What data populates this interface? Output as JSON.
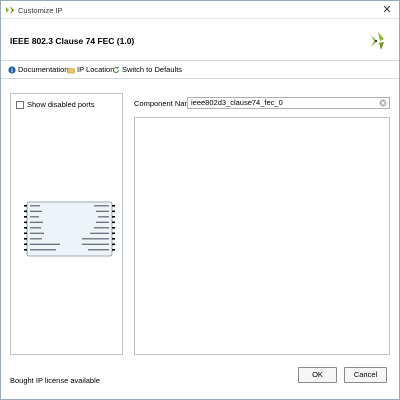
{
  "window": {
    "title": "Customize IP"
  },
  "header": {
    "ip_title": "IEEE 802.3 Clause 74 FEC (1.0)"
  },
  "toolbar": {
    "documentation_label": "Documentation",
    "ip_location_label": "IP Location",
    "switch_defaults_label": "Switch to Defaults"
  },
  "left_panel": {
    "show_disabled_ports_label": "Show disabled ports",
    "show_disabled_ports_checked": false
  },
  "component": {
    "label": "Component Name",
    "value": "ieee802d3_clause74_fec_0"
  },
  "footer": {
    "license_text": "Bought IP license available",
    "ok_label": "OK",
    "cancel_label": "Cancel"
  },
  "icons": {
    "app": "xilinx-logo-icon",
    "close": "close-icon",
    "documentation": "info-icon",
    "ip_location": "folder-icon",
    "switch_defaults": "refresh-icon",
    "clear": "clear-icon"
  },
  "colors": {
    "logo_green": "#8ab82a",
    "logo_dark": "#3a3a3a",
    "border": "#b8c0c8"
  }
}
